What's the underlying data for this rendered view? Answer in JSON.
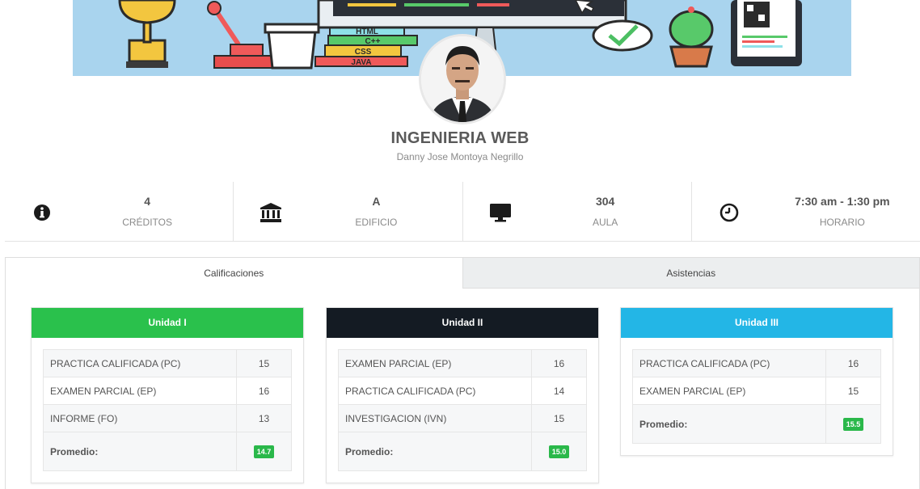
{
  "course": {
    "title": "INGENIERIA WEB",
    "teacher": "Danny Jose Montoya Negrillo"
  },
  "banner": {
    "book_labels": [
      "HTML",
      "C++",
      "CSS",
      "JAVA"
    ]
  },
  "stats": [
    {
      "icon": "info-icon",
      "value": "4",
      "label": "CRÉDITOS"
    },
    {
      "icon": "building-icon",
      "value": "A",
      "label": "EDIFICIO"
    },
    {
      "icon": "monitor-icon",
      "value": "304",
      "label": "AULA"
    },
    {
      "icon": "clock-icon",
      "value": "7:30 am - 1:30 pm",
      "label": "HORARIO"
    }
  ],
  "tabs": [
    {
      "label": "Calificaciones",
      "active": true
    },
    {
      "label": "Asistencias",
      "active": false
    }
  ],
  "units": [
    {
      "title": "Unidad I",
      "color": "#2ac14c",
      "rows": [
        {
          "name": "PRACTICA CALIFICADA (PC)",
          "score": "15"
        },
        {
          "name": "EXAMEN PARCIAL (EP)",
          "score": "16"
        },
        {
          "name": "INFORME (FO)",
          "score": "13"
        }
      ],
      "average_label": "Promedio:",
      "average": "14.7"
    },
    {
      "title": "Unidad II",
      "color": "#141b23",
      "rows": [
        {
          "name": "EXAMEN PARCIAL (EP)",
          "score": "16"
        },
        {
          "name": "PRACTICA CALIFICADA (PC)",
          "score": "14"
        },
        {
          "name": "INVESTIGACION (IVN)",
          "score": "15"
        }
      ],
      "average_label": "Promedio:",
      "average": "15.0"
    },
    {
      "title": "Unidad III",
      "color": "#23b6e6",
      "rows": [
        {
          "name": "PRACTICA CALIFICADA (PC)",
          "score": "16"
        },
        {
          "name": "EXAMEN PARCIAL (EP)",
          "score": "15"
        }
      ],
      "average_label": "Promedio:",
      "average": "15.5"
    }
  ]
}
